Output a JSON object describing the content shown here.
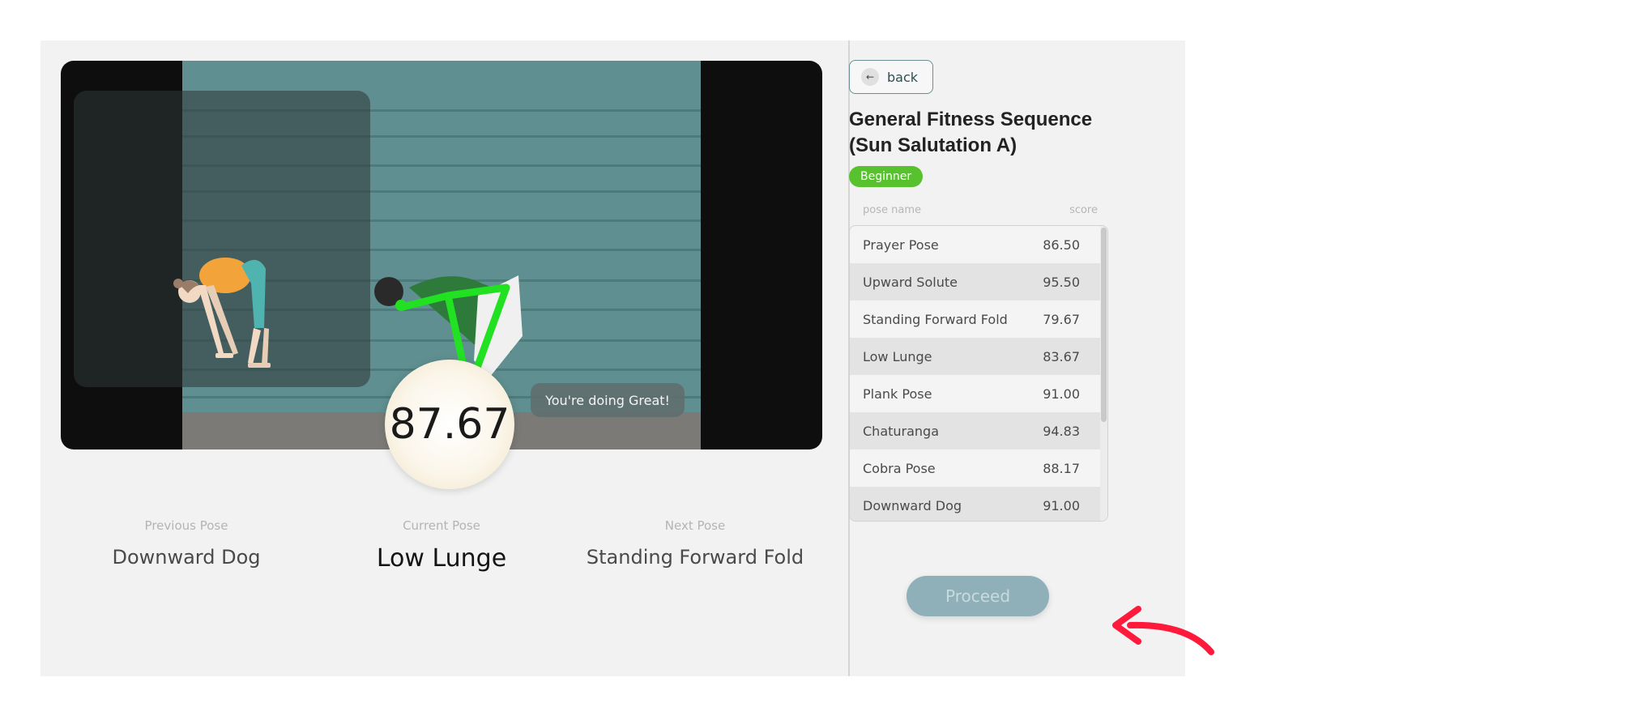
{
  "video": {
    "feedback_message": "You're doing Great!",
    "score": "87.67"
  },
  "poses": {
    "previous_label": "Previous Pose",
    "previous_value": "Downward Dog",
    "current_label": "Current Pose",
    "current_value": "Low Lunge",
    "next_label": "Next Pose",
    "next_value": "Standing Forward Fold"
  },
  "sidebar": {
    "back_label": "back",
    "title": "General Fitness Sequence (Sun Salutation A)",
    "level": "Beginner",
    "table_headers": {
      "name": "pose name",
      "score": "score"
    },
    "rows": [
      {
        "name": "Prayer Pose",
        "score": "86.50"
      },
      {
        "name": "Upward Solute",
        "score": "95.50"
      },
      {
        "name": "Standing Forward Fold",
        "score": "79.67"
      },
      {
        "name": "Low Lunge",
        "score": "83.67"
      },
      {
        "name": "Plank Pose",
        "score": "91.00"
      },
      {
        "name": "Chaturanga",
        "score": "94.83"
      },
      {
        "name": "Cobra Pose",
        "score": "88.17"
      },
      {
        "name": "Downward Dog",
        "score": "91.00"
      }
    ],
    "proceed_label": "Proceed"
  },
  "colors": {
    "badge": "#57c22d",
    "proceed": "#8fb0b9",
    "skeleton": "#22e022",
    "annotation_arrow": "#ff1a3c"
  }
}
